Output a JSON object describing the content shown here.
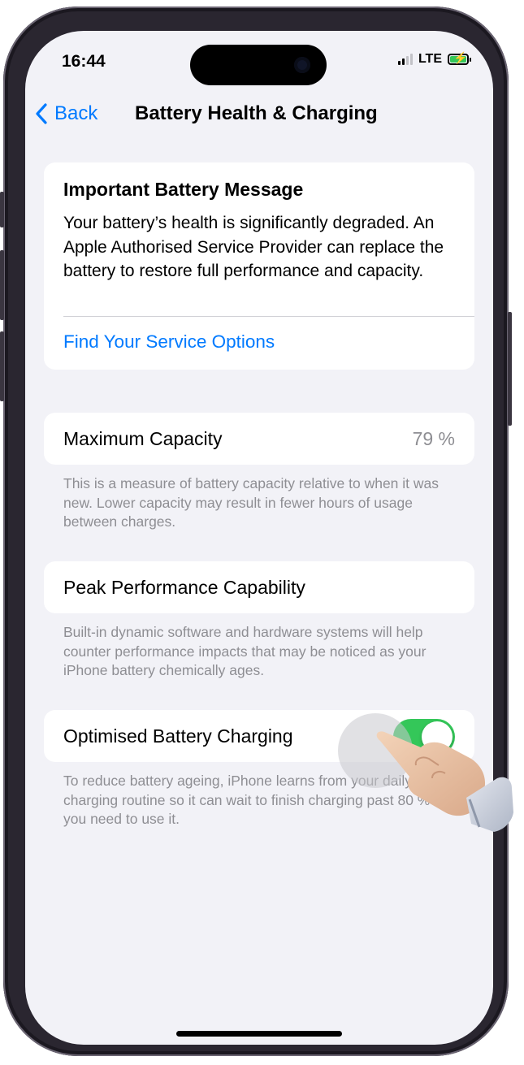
{
  "status_bar": {
    "time": "16:44",
    "network": "LTE"
  },
  "nav": {
    "back_label": "Back",
    "title": "Battery Health & Charging"
  },
  "message_card": {
    "title": "Important Battery Message",
    "body": "Your battery’s health is significantly degraded. An Apple Authorised Service Provider can replace the battery to restore full performance and capacity.",
    "link": "Find Your Service Options"
  },
  "capacity": {
    "label": "Maximum Capacity",
    "value": "79 %",
    "footer": "This is a measure of battery capacity relative to when it was new. Lower capacity may result in fewer hours of usage between charges."
  },
  "peak": {
    "label": "Peak Performance Capability",
    "footer": "Built-in dynamic software and hardware systems will help counter performance impacts that may be noticed as your iPhone battery chemically ages."
  },
  "optimised": {
    "label": "Optimised Battery Charging",
    "toggle_on": true,
    "footer": "To reduce battery ageing, iPhone learns from your daily charging routine so it can wait to finish charging past 80 % until you need to use it."
  },
  "colors": {
    "accent": "#007aff",
    "toggle_on": "#34c759",
    "background": "#f2f2f7"
  }
}
